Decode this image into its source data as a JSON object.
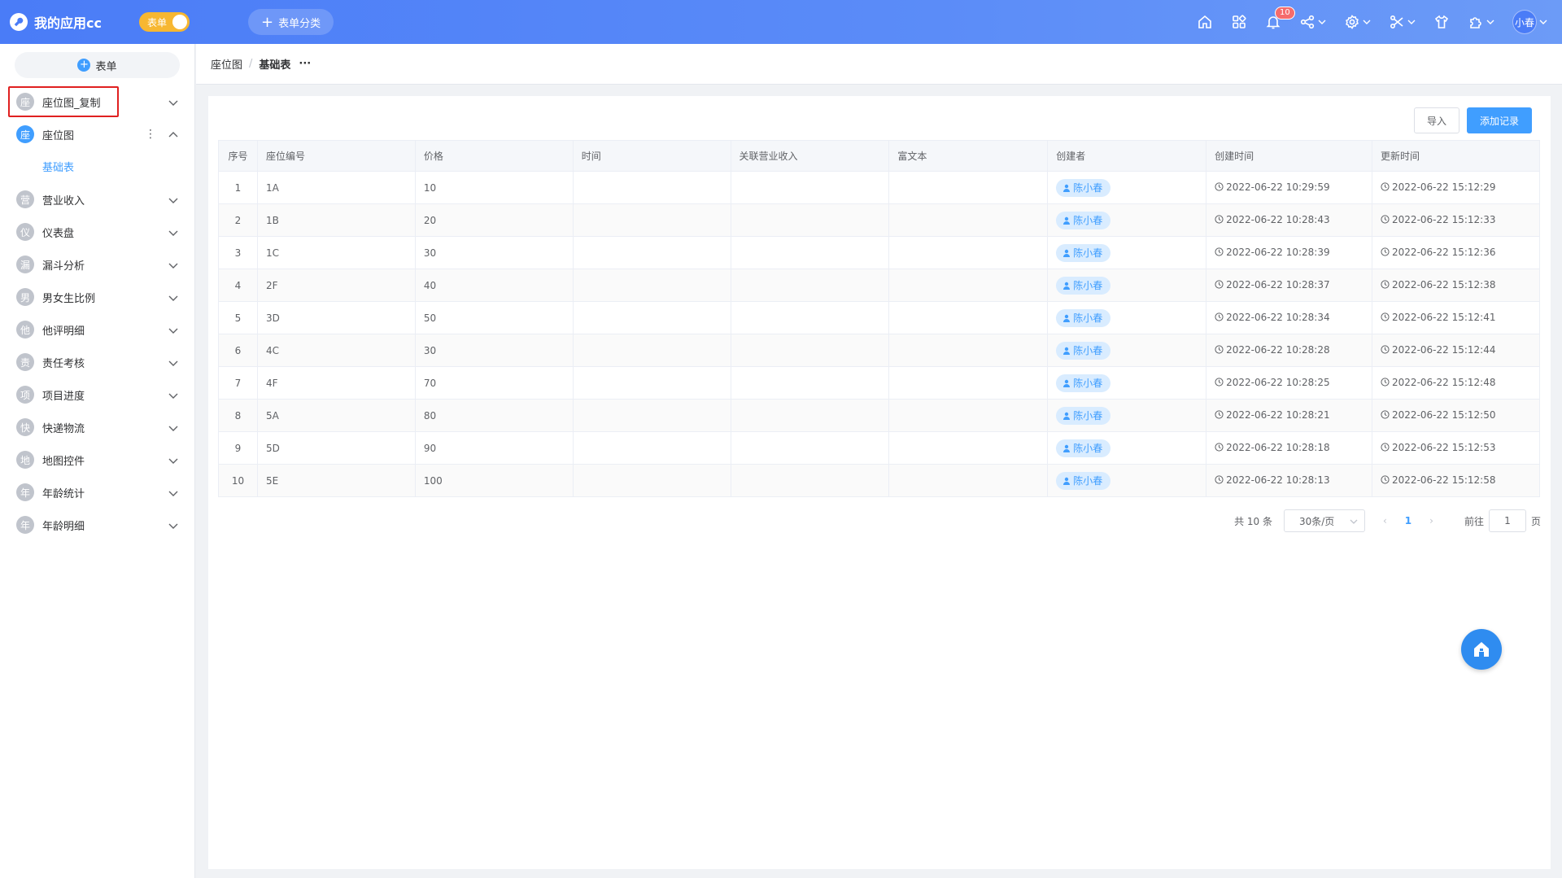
{
  "header": {
    "app_name": "我的应用cc",
    "toggle_label": "表单",
    "category_button": "表单分类",
    "notification_count": "10",
    "user_avatar": "小春",
    "icons": [
      "home-icon",
      "apps-grid-icon",
      "bell-icon",
      "share-icon",
      "settings-icon",
      "tools-icon",
      "shirt-icon",
      "puzzle-icon"
    ]
  },
  "sidebar": {
    "add_form_label": "表单",
    "items": [
      {
        "icon_char": "座",
        "label": "座位图_复制"
      },
      {
        "icon_char": "座",
        "label": "座位图"
      },
      {
        "icon_char": "营",
        "label": "营业收入"
      },
      {
        "icon_char": "仪",
        "label": "仪表盘"
      },
      {
        "icon_char": "漏",
        "label": "漏斗分析"
      },
      {
        "icon_char": "男",
        "label": "男女生比例"
      },
      {
        "icon_char": "他",
        "label": "他评明细"
      },
      {
        "icon_char": "责",
        "label": "责任考核"
      },
      {
        "icon_char": "项",
        "label": "项目进度"
      },
      {
        "icon_char": "快",
        "label": "快递物流"
      },
      {
        "icon_char": "地",
        "label": "地图控件"
      },
      {
        "icon_char": "年",
        "label": "年龄统计"
      },
      {
        "icon_char": "年",
        "label": "年龄明细"
      }
    ],
    "sub_item": "基础表"
  },
  "breadcrumb": {
    "parent": "座位图",
    "separator": "/",
    "current": "基础表",
    "more": "···"
  },
  "toolbar": {
    "import_label": "导入",
    "add_label": "添加记录"
  },
  "table": {
    "columns": [
      "序号",
      "座位编号",
      "价格",
      "时间",
      "关联营业收入",
      "富文本",
      "创建者",
      "创建时间",
      "更新时间"
    ],
    "rows": [
      {
        "idx": "1",
        "seat": "1A",
        "price": "10",
        "creator": "陈小春",
        "created": "2022-06-22 10:29:59",
        "updated": "2022-06-22 15:12:29"
      },
      {
        "idx": "2",
        "seat": "1B",
        "price": "20",
        "creator": "陈小春",
        "created": "2022-06-22 10:28:43",
        "updated": "2022-06-22 15:12:33"
      },
      {
        "idx": "3",
        "seat": "1C",
        "price": "30",
        "creator": "陈小春",
        "created": "2022-06-22 10:28:39",
        "updated": "2022-06-22 15:12:36"
      },
      {
        "idx": "4",
        "seat": "2F",
        "price": "40",
        "creator": "陈小春",
        "created": "2022-06-22 10:28:37",
        "updated": "2022-06-22 15:12:38"
      },
      {
        "idx": "5",
        "seat": "3D",
        "price": "50",
        "creator": "陈小春",
        "created": "2022-06-22 10:28:34",
        "updated": "2022-06-22 15:12:41"
      },
      {
        "idx": "6",
        "seat": "4C",
        "price": "30",
        "creator": "陈小春",
        "created": "2022-06-22 10:28:28",
        "updated": "2022-06-22 15:12:44"
      },
      {
        "idx": "7",
        "seat": "4F",
        "price": "70",
        "creator": "陈小春",
        "created": "2022-06-22 10:28:25",
        "updated": "2022-06-22 15:12:48"
      },
      {
        "idx": "8",
        "seat": "5A",
        "price": "80",
        "creator": "陈小春",
        "created": "2022-06-22 10:28:21",
        "updated": "2022-06-22 15:12:50"
      },
      {
        "idx": "9",
        "seat": "5D",
        "price": "90",
        "creator": "陈小春",
        "created": "2022-06-22 10:28:18",
        "updated": "2022-06-22 15:12:53"
      },
      {
        "idx": "10",
        "seat": "5E",
        "price": "100",
        "creator": "陈小春",
        "created": "2022-06-22 10:28:13",
        "updated": "2022-06-22 15:12:58"
      }
    ]
  },
  "pager": {
    "total": "共 10 条",
    "page_size": "30条/页",
    "prev": "‹",
    "current_page": "1",
    "next": "›",
    "goto_label": "前往",
    "goto_value": "1",
    "page_unit": "页"
  },
  "colors": {
    "primary": "#409eff",
    "header": "#4a7cf7",
    "toggle": "#f7b731",
    "highlight": "#e02020"
  }
}
